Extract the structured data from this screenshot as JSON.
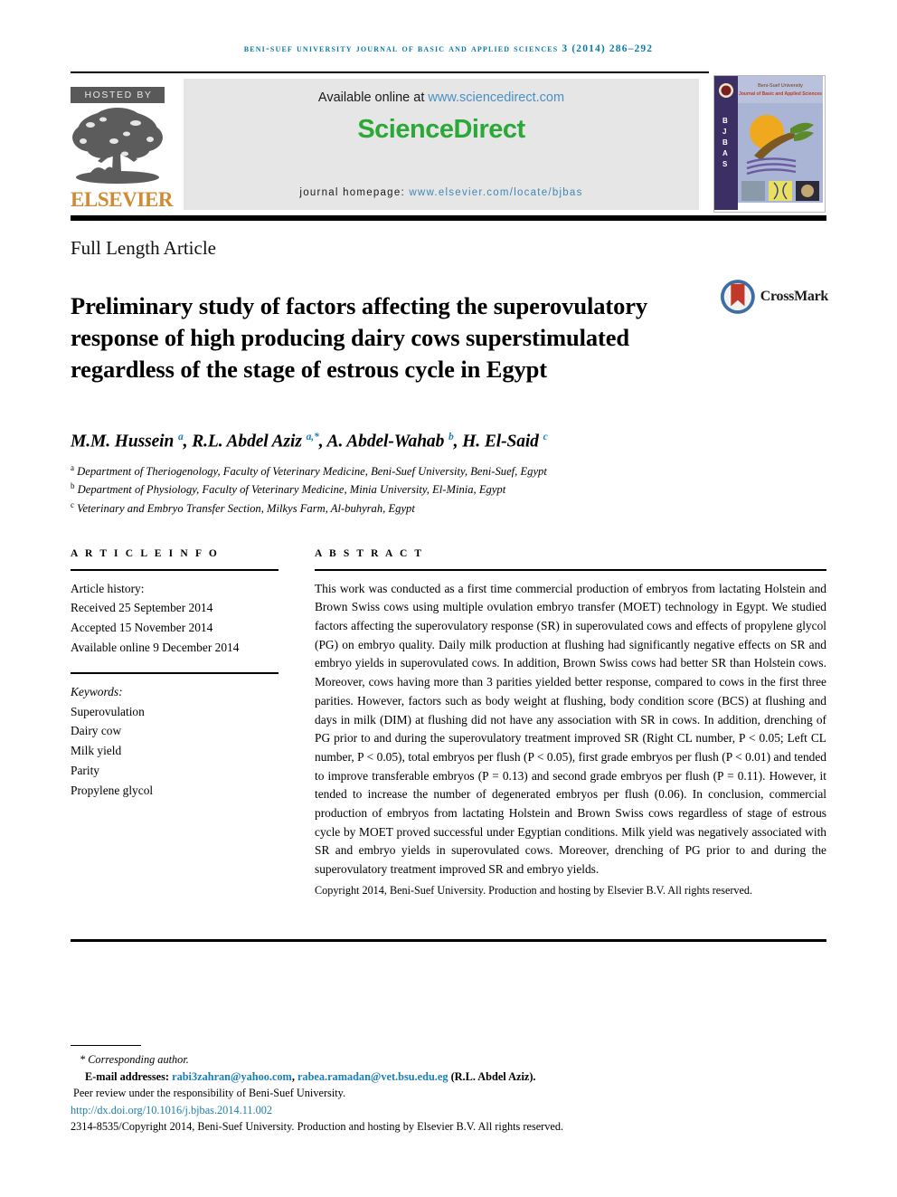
{
  "running_head": "Beni-Suef University Journal of Basic and Applied Sciences 3 (2014) 286–292",
  "header": {
    "hosted_by_label": "HOSTED BY",
    "publisher_name": "ELSEVIER",
    "publisher_logo_icon": "elsevier-tree-icon",
    "available_online_prefix": "Available online at ",
    "available_online_link": "www.sciencedirect.com",
    "sciencedirect_logo": "ScienceDirect",
    "journal_homepage_prefix": "journal homepage: ",
    "journal_homepage_link": "www.elsevier.com/locate/bjbas",
    "cover": {
      "university": "Beni-Suef University",
      "journal_title": "Journal of Basic and Applied Sciences",
      "spine_letters": "B J B A S"
    },
    "colors": {
      "running_head": "#0a7ba8",
      "sciencedirect_green": "#2ba937",
      "link_blue": "#3f87b5",
      "elsevier_orange": "#cf8a33",
      "panel_grey": "#e6e6e6"
    }
  },
  "article": {
    "type": "Full Length Article",
    "title": "Preliminary study of factors affecting the superovulatory response of high producing dairy cows superstimulated regardless of the stage of estrous cycle in Egypt",
    "crossmark_label": "CrossMark",
    "authors_html": "M.M. Hussein <sup>a</sup>, R.L. Abdel Aziz <sup>a,*</sup>, A. Abdel-Wahab <sup>b</sup>, H. El-Said <sup>c</sup>",
    "affiliations": [
      {
        "marker": "a",
        "text": "Department of Theriogenology, Faculty of Veterinary Medicine, Beni-Suef University, Beni-Suef, Egypt"
      },
      {
        "marker": "b",
        "text": "Department of Physiology, Faculty of Veterinary Medicine, Minia University, El-Minia, Egypt"
      },
      {
        "marker": "c",
        "text": "Veterinary and Embryo Transfer Section, Milkys Farm, Al-buhyrah, Egypt"
      }
    ]
  },
  "article_info": {
    "heading": "A R T I C L E   I N F O",
    "history_title": "Article history:",
    "history": [
      "Received 25 September 2014",
      "Accepted 15 November 2014",
      "Available online 9 December 2014"
    ],
    "keywords_title": "Keywords:",
    "keywords": [
      "Superovulation",
      "Dairy cow",
      "Milk yield",
      "Parity",
      "Propylene glycol"
    ]
  },
  "abstract": {
    "heading": "A B S T R A C T",
    "body": "This work was conducted as a first time commercial production of embryos from lactating Holstein and Brown Swiss cows using multiple ovulation embryo transfer (MOET) technology in Egypt. We studied factors affecting the superovulatory response (SR) in superovulated cows and effects of propylene glycol (PG) on embryo quality. Daily milk production at flushing had significantly negative effects on SR and embryo yields in superovulated cows. In addition, Brown Swiss cows had better SR than Holstein cows. Moreover, cows having more than 3 parities yielded better response, compared to cows in the first three parities. However, factors such as body weight at flushing, body condition score (BCS) at flushing and days in milk (DIM) at flushing did not have any association with SR in cows. In addition, drenching of PG prior to and during the superovulatory treatment improved SR (Right CL number, P < 0.05; Left CL number, P < 0.05), total embryos per flush (P < 0.05), first grade embryos per flush (P < 0.01) and tended to improve transferable embryos (P = 0.13) and second grade embryos per flush (P = 0.11). However, it tended to increase the number of degenerated embryos per flush (0.06). In conclusion, commercial production of embryos from lactating Holstein and Brown Swiss cows regardless of stage of estrous cycle by MOET proved successful under Egyptian conditions. Milk yield was negatively associated with SR and embryo yields in superovulated cows. Moreover, drenching of PG prior to and during the superovulatory treatment improved SR and embryo yields.",
    "copyright": "Copyright 2014, Beni-Suef University. Production and hosting by Elsevier B.V. All rights reserved."
  },
  "footnote": {
    "corresponding": "* Corresponding author.",
    "email_label": "E-mail addresses:",
    "email_1": "rabi3zahran@yahoo.com",
    "email_sep": ", ",
    "email_2": "rabea.ramadan@vet.bsu.edu.eg",
    "email_attrib": " (R.L. Abdel Aziz).",
    "peer_review": "Peer review under the responsibility of Beni-Suef University.",
    "doi": "http://dx.doi.org/10.1016/j.bjbas.2014.11.002",
    "issn_line": "2314-8535/Copyright 2014, Beni-Suef University. Production and hosting by Elsevier B.V. All rights reserved."
  }
}
